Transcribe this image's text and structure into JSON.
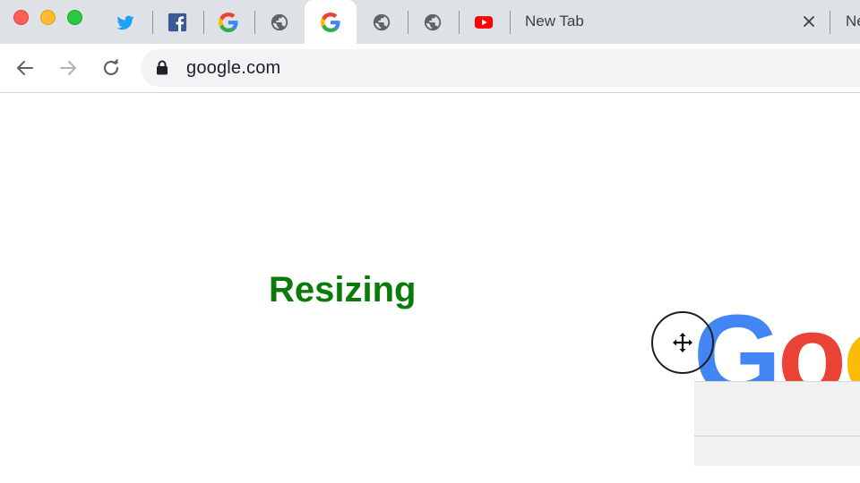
{
  "browser": {
    "tabs": [
      {
        "icon": "twitter-icon",
        "active": false
      },
      {
        "icon": "facebook-icon",
        "active": false
      },
      {
        "icon": "google-icon",
        "active": false
      },
      {
        "icon": "globe-icon",
        "active": false
      },
      {
        "icon": "google-icon",
        "active": true
      },
      {
        "icon": "globe-icon",
        "active": false
      },
      {
        "icon": "globe-icon",
        "active": false
      },
      {
        "icon": "youtube-icon",
        "active": false
      }
    ],
    "new_tab_label": "New Tab",
    "cut_tab_label": "Ne",
    "address": "google.com"
  },
  "page": {
    "status_text": "Resizing",
    "logo_letters": [
      "G",
      "o",
      "o"
    ]
  },
  "colors": {
    "status_text": "#0a7a0a",
    "google_blue": "#4285f4",
    "google_red": "#ea4335",
    "google_yellow": "#fbbc05",
    "tabstrip": "#dee1e6"
  }
}
